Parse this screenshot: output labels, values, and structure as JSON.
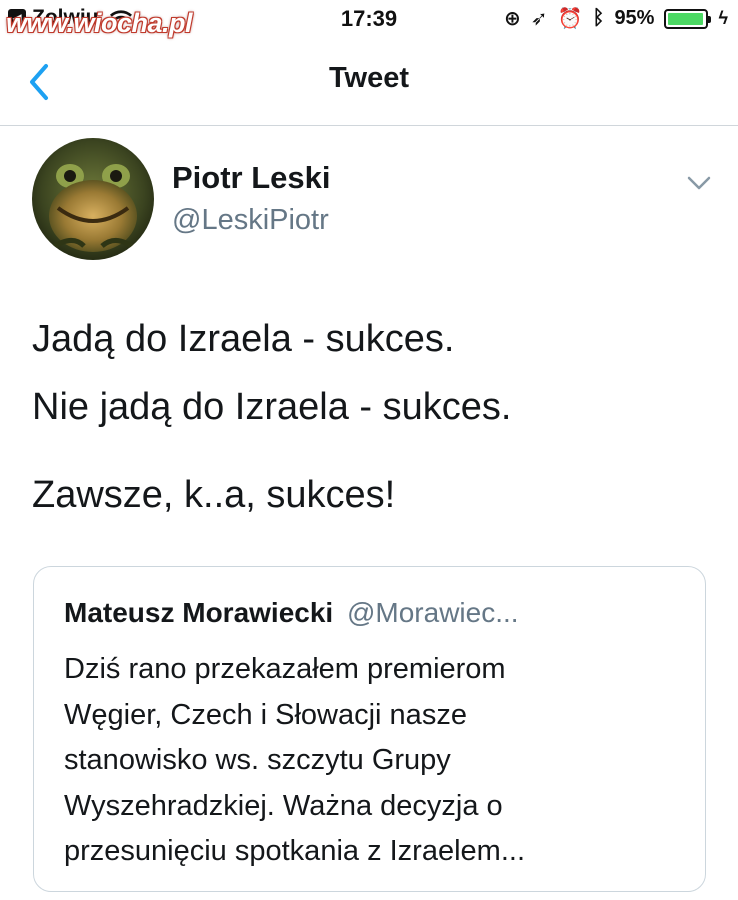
{
  "status_bar": {
    "carrier": "Zolwiu",
    "watermark": "www.wiocha.pl",
    "time": "17:39",
    "battery_percent": "95%",
    "battery_level": 0.95,
    "icons": [
      "wifi-icon",
      "rotation-lock-icon",
      "location-icon",
      "alarm-icon",
      "bluetooth-icon",
      "battery-icon",
      "charging-icon"
    ]
  },
  "nav": {
    "title": "Tweet",
    "back_icon": "chevron-left-icon"
  },
  "tweet": {
    "author_name": "Piotr Leski",
    "author_handle": "@LeskiPiotr",
    "more_icon": "chevron-down-icon",
    "lines": [
      "Jadą do Izraela - sukces.",
      "Nie jadą do Izraela - sukces.",
      "Zawsze, k..a, sukces!"
    ]
  },
  "quoted_tweet": {
    "author_name": "Mateusz Morawiecki",
    "author_handle": "@Morawiec...",
    "lines": [
      "Dziś rano przekazałem premierom",
      "Węgier, Czech i Słowacji nasze",
      "stanowisko ws. szczytu Grupy",
      "Wyszehradzkiej. Ważna decyzja o",
      "przesunięciu spotkania z Izraelem..."
    ]
  },
  "colors": {
    "accent": "#1da1f2",
    "text": "#14171a",
    "secondary_text": "#657786",
    "border": "#ccd6dd",
    "battery_green": "#4cd964",
    "watermark_red": "#c0392b"
  }
}
